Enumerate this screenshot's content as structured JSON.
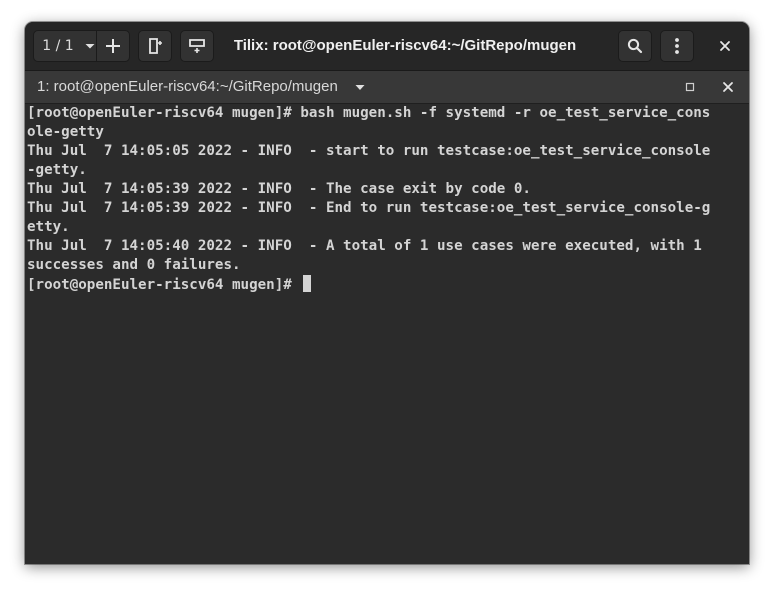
{
  "window": {
    "title": "Tilix: root@openEuler-riscv64:~/GitRepo/mugen"
  },
  "headerbar": {
    "session_count": "1 / 1",
    "icons": {
      "session_menu": "chevron-down-icon",
      "add_session": "plus-icon",
      "split_right": "split-right-icon",
      "split_down": "split-down-icon",
      "search": "search-icon",
      "menu": "vertical-ellipsis-icon",
      "close": "close-icon"
    }
  },
  "tab": {
    "title": "1: root@openEuler-riscv64:~/GitRepo/mugen",
    "icons": {
      "dropdown": "chevron-down-icon",
      "maximize": "maximize-icon",
      "close": "close-icon"
    }
  },
  "terminal": {
    "lines": [
      "[root@openEuler-riscv64 mugen]# bash mugen.sh -f systemd -r oe_test_service_cons",
      "ole-getty",
      "Thu Jul  7 14:05:05 2022 - INFO  - start to run testcase:oe_test_service_console",
      "-getty.",
      "Thu Jul  7 14:05:39 2022 - INFO  - The case exit by code 0.",
      "Thu Jul  7 14:05:39 2022 - INFO  - End to run testcase:oe_test_service_console-g",
      "etty.",
      "Thu Jul  7 14:05:40 2022 - INFO  - A total of 1 use cases were executed, with 1",
      "successes and 0 failures.",
      "[root@openEuler-riscv64 mugen]# "
    ]
  },
  "colors": {
    "headerbar": "#262626",
    "tabbar": "#383838",
    "terminal_bg": "#2b2b2b",
    "terminal_fg": "#d4d4d4"
  }
}
